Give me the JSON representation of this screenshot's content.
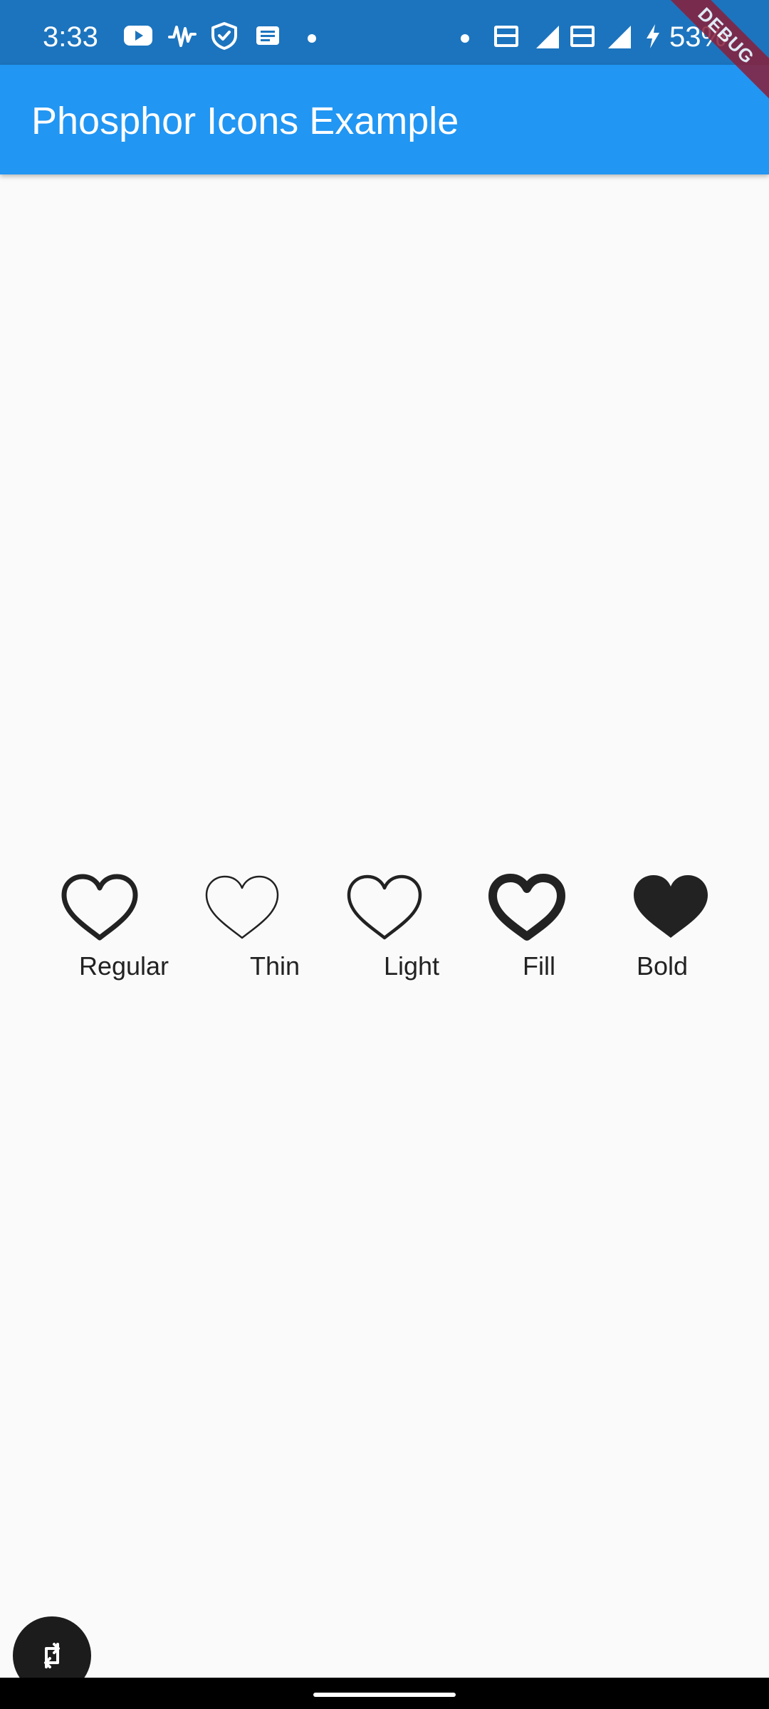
{
  "status_bar": {
    "time": "3:33",
    "battery": "53%",
    "icons": [
      "youtube-icon",
      "audio-wave-icon",
      "shield-check-icon",
      "message-icon",
      "dot-icon",
      "dot-icon",
      "volte-icon",
      "signal-roaming-icon",
      "volte-icon",
      "signal-icon",
      "charging-icon"
    ]
  },
  "app_bar": {
    "title": "Phosphor Icons Example"
  },
  "debug_banner": "DEBUG",
  "icon_weights": [
    {
      "label": "Regular",
      "icon": "heart-regular-icon"
    },
    {
      "label": "Thin",
      "icon": "heart-thin-icon"
    },
    {
      "label": "Light",
      "icon": "heart-light-icon"
    },
    {
      "label": "Fill",
      "icon": "heart-bold-icon"
    },
    {
      "label": "Bold",
      "icon": "heart-fill-icon"
    }
  ],
  "fab": {
    "icon": "swap-icon"
  },
  "colors": {
    "status_bar": "#1c74be",
    "app_bar": "#2196f3",
    "background": "#fafafa",
    "icon": "#222222"
  }
}
